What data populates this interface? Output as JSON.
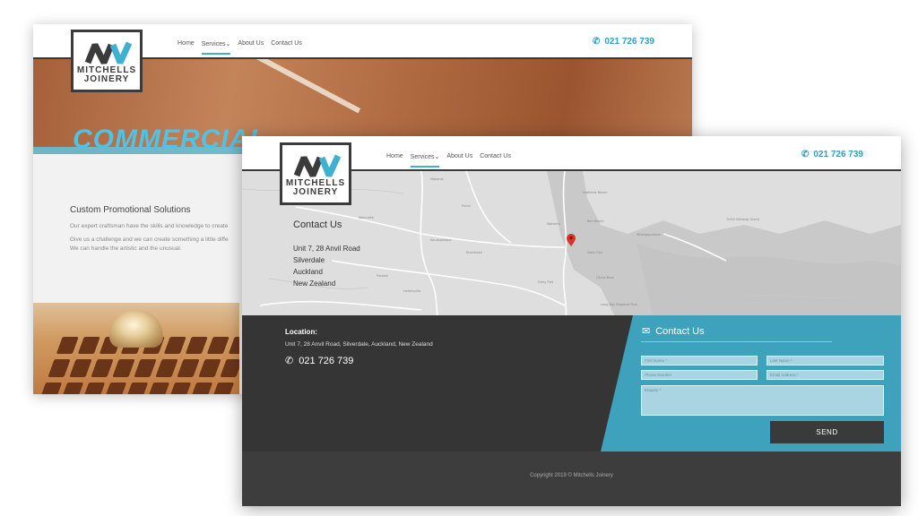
{
  "back": {
    "logo_line1": "MITCHELLS",
    "logo_line2": "JOINERY",
    "nav": [
      "Home",
      "Services",
      "About Us",
      "Contact Us"
    ],
    "phone": "021 726 739",
    "hero_title": "COMMERCIAL",
    "section_title": "Custom Promotional Solutions",
    "para1": "Our expert craftsman have the skills and knowledge to create",
    "para2": "Give us a challenge and we can create something a little diffe",
    "para3": "We can handle the artistic and the unusual."
  },
  "front": {
    "logo_line1": "MITCHELLS",
    "logo_line2": "JOINERY",
    "nav": [
      "Home",
      "Services",
      "About Us",
      "Contact Us"
    ],
    "phone": "021 726 739",
    "map_contact_title": "Contact Us",
    "address_lines": [
      "Unit 7, 28 Anvil Road",
      "Silverdale",
      "Auckland",
      "New Zealand"
    ],
    "location_label": "Location:",
    "location_address": "Unit 7, 28 Anvil Road, Silverdale, Auckland, New Zealand",
    "location_phone": "021 726 739",
    "form_title": "Contact Us",
    "form_fields": {
      "first_name": "First Name *",
      "last_name": "Last Name *",
      "phone_number": "Phone Number",
      "email": "Email Address *",
      "enquiry": "Enquiry *"
    },
    "send_label": "SEND",
    "copyright": "Copyright 2019 © Mitchells Joinery"
  },
  "colors": {
    "accent": "#3fb0d0",
    "form_panel": "#3ea2bd",
    "dark": "#353535",
    "logo": "#3b3b3b"
  }
}
